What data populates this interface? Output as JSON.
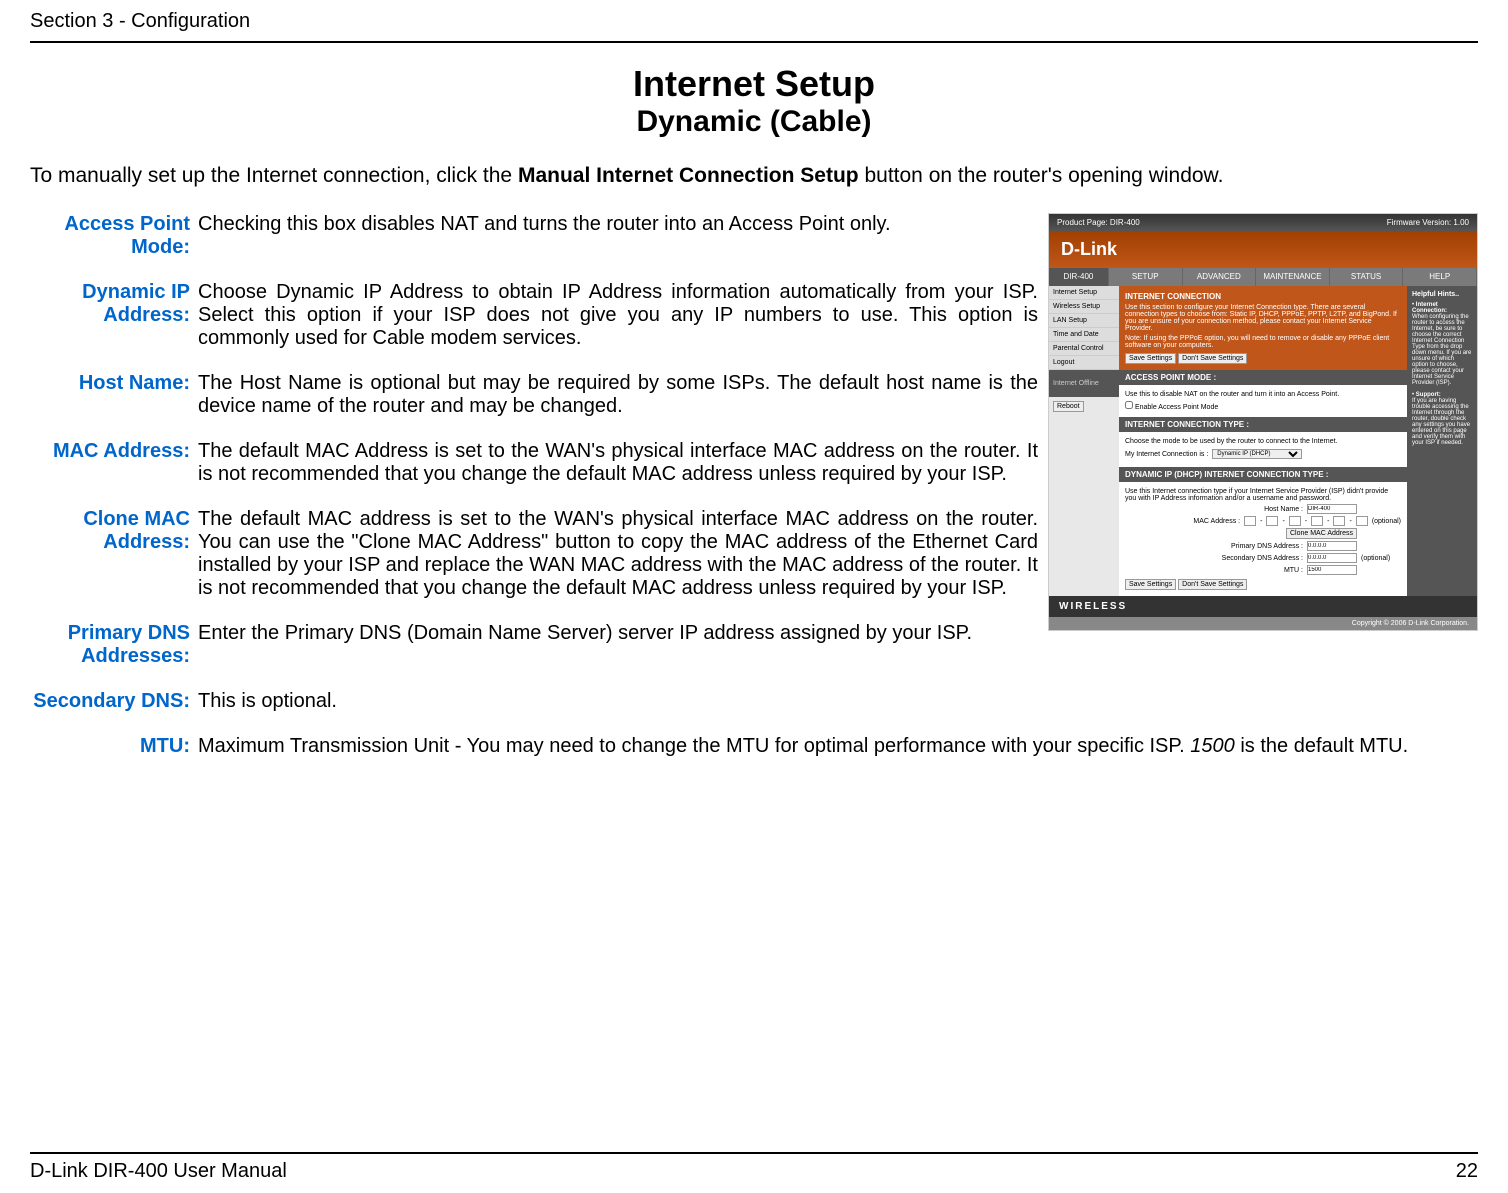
{
  "header": {
    "section": "Section 3 - Configuration"
  },
  "titles": {
    "main": "Internet Setup",
    "sub": "Dynamic (Cable)"
  },
  "intro": {
    "pre": "To manually set up the Internet connection, click the ",
    "bold": "Manual Internet Connection Setup",
    "post": " button on the router's opening window."
  },
  "definitions": {
    "accessPoint": {
      "label": "Access Point Mode:",
      "text": "Checking this box disables NAT and turns the router into an Access Point only."
    },
    "dynamicIP": {
      "label": "Dynamic IP Address:",
      "text": "Choose Dynamic IP Address to obtain IP Address information automatically from your ISP. Select this option if your ISP does not give you any IP numbers to use. This option is commonly used for Cable modem services."
    },
    "hostName": {
      "label": "Host Name:",
      "text": "The Host Name is optional but may be required by some ISPs. The default host name is the device name of the router and may be changed."
    },
    "macAddress": {
      "label": "MAC Address:",
      "text": "The default MAC Address is set to the WAN's physical interface MAC address on the router. It is not recommended that you change the default MAC address unless required by your ISP."
    },
    "cloneMac": {
      "label": "Clone MAC Address:",
      "text": "The default MAC address is set to the WAN's physical interface MAC address on the router. You can use the \"Clone MAC Address\" button to copy the MAC address of the Ethernet Card installed by your ISP and replace the WAN MAC address with the MAC address of the router. It is not recommended that you change the default MAC address unless required by your ISP."
    },
    "primaryDNS": {
      "label": "Primary DNS Addresses:",
      "text": "Enter the Primary DNS (Domain Name Server) server IP address assigned by your ISP."
    },
    "secondaryDNS": {
      "label": "Secondary DNS:",
      "text": "This is optional."
    },
    "mtu": {
      "label": "MTU:",
      "text_pre": "Maximum Transmission Unit - You may need to change the MTU for optimal performance with your specific ISP.  ",
      "text_italic": "1500",
      "text_post": " is the default MTU."
    }
  },
  "routerUI": {
    "productPage": "Product Page: DIR-400",
    "firmware": "Firmware Version: 1.00",
    "brand": "D-Link",
    "model": "DIR-400",
    "nav": {
      "setup": "SETUP",
      "advanced": "ADVANCED",
      "maintenance": "MAINTENANCE",
      "status": "STATUS",
      "help": "HELP"
    },
    "sidebar": {
      "internetSetup": "Internet Setup",
      "wirelessSetup": "Wireless Setup",
      "lanSetup": "LAN Setup",
      "timeDate": "Time and Date",
      "parentalControl": "Parental Control",
      "logout": "Logout",
      "offline": "Internet Offline",
      "reboot": "Reboot"
    },
    "mainPanel": {
      "title": "INTERNET CONNECTION",
      "desc": "Use this section to configure your Internet Connection type. There are several connection types to choose from: Static IP, DHCP, PPPoE, PPTP, L2TP, and BigPond. If you are unsure of your connection method, please contact your Internet Service Provider.",
      "note": "Note: If using the PPPoE option, you will need to remove or disable any PPPoE client software on your computers.",
      "saveBtn": "Save Settings",
      "dontSaveBtn": "Don't Save Settings",
      "apModeTitle": "ACCESS POINT MODE :",
      "apModeDesc": "Use this to disable NAT on the router and turn it into an Access Point.",
      "apModeCheck": "Enable Access Point Mode",
      "connTypeTitle": "INTERNET CONNECTION TYPE :",
      "connTypeDesc": "Choose the mode to be used by the router to connect to the Internet.",
      "connTypeLabel": "My Internet Connection is :",
      "connTypeValue": "Dynamic IP (DHCP)",
      "dhcpTitle": "DYNAMIC IP (DHCP) INTERNET CONNECTION TYPE :",
      "dhcpDesc": "Use this Internet connection type if your Internet Service Provider (ISP) didn't provide you with IP Address information and/or a username and password.",
      "hostNameLabel": "Host Name :",
      "hostNameValue": "DIR-400",
      "macLabel": "MAC Address :",
      "cloneBtn": "Clone MAC Address",
      "primaryDnsLabel": "Primary DNS Address :",
      "primaryDnsValue": "0.0.0.0",
      "secondaryDnsLabel": "Secondary DNS Address :",
      "secondaryDnsValue": "0.0.0.0",
      "optional": "(optional)",
      "mtuLabel": "MTU :",
      "mtuValue": "1500"
    },
    "hints": {
      "title": "Helpful Hints..",
      "h1": "Internet Connection:",
      "t1": "When configuring the router to access the Internet, be sure to choose the correct Internet Connection Type from the drop down menu. If you are unsure of which option to choose, please contact your Internet Service Provider (ISP).",
      "h2": "Support:",
      "t2": "If you are having trouble accessing the Internet through the router, double check any settings you have entered on this page and verify them with your ISP if needed."
    },
    "wireless": "WIRELESS",
    "copyright": "Copyright © 2006 D-Link Corporation."
  },
  "footer": {
    "left": "D-Link DIR-400 User Manual",
    "right": "22"
  }
}
